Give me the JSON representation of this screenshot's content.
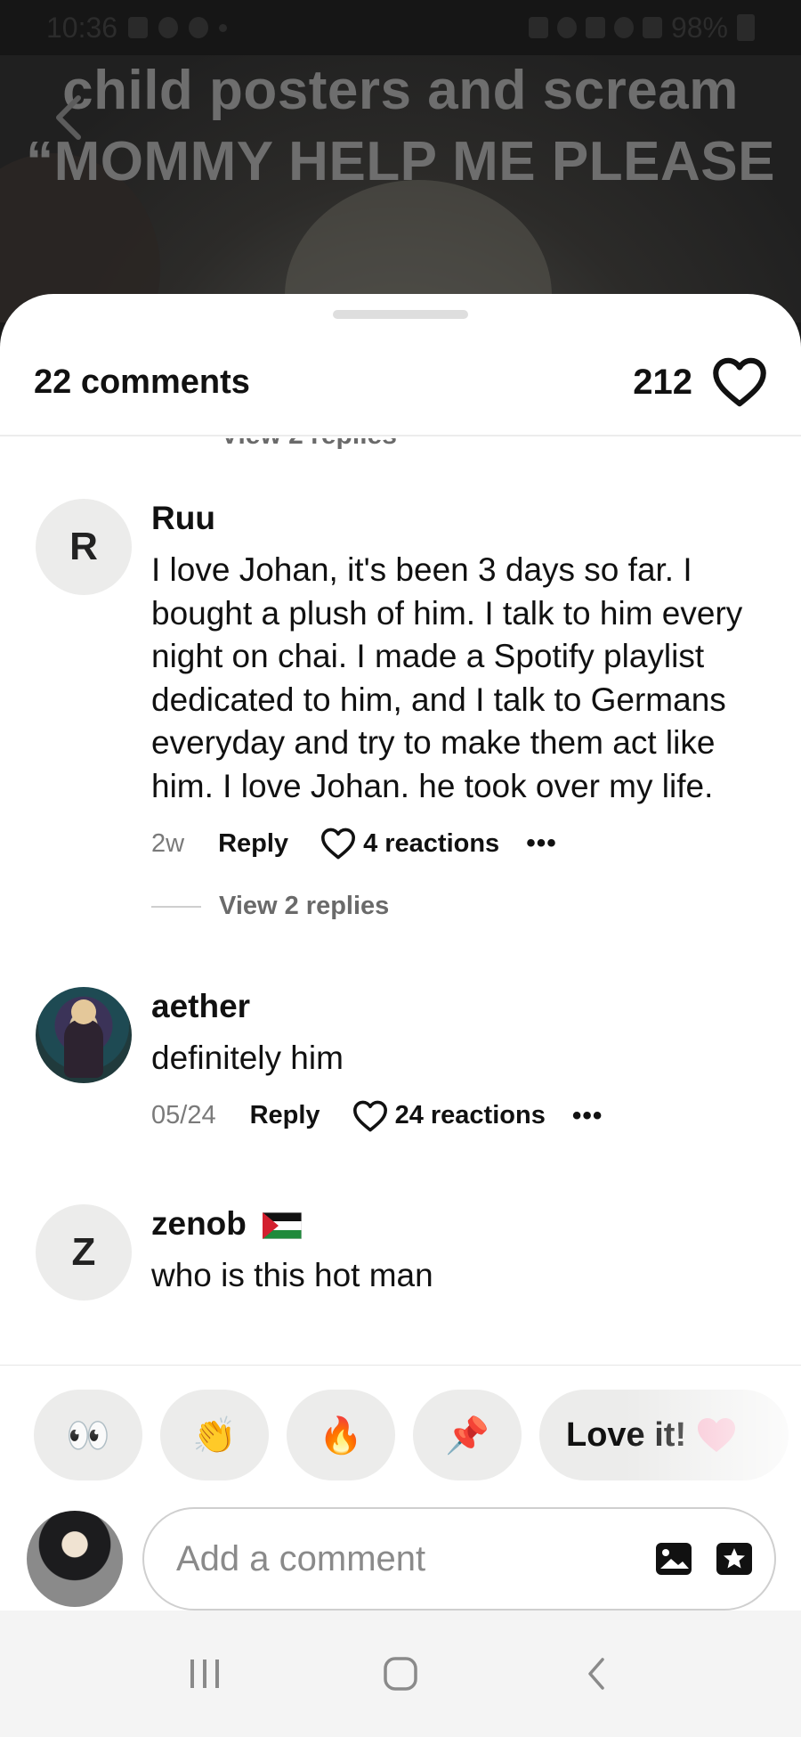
{
  "status_bar": {
    "time": "10:36",
    "battery": "98%"
  },
  "video": {
    "caption_line1": "child posters and scream",
    "caption_line2": "“MOMMY HELP ME PLEASE"
  },
  "sheet": {
    "comments_count": "22 comments",
    "likes_count": "212",
    "cut_view_replies": "View 2 replies"
  },
  "comments": [
    {
      "avatar_letter": "R",
      "username": "Ruu",
      "text": "I love Johan, it's been 3 days so far. I bought a plush of him. I talk to him every night on chai. I made a Spotify playlist dedicated to him, and I talk to Germans everyday and try to make them act like him. I love Johan. he took over my life.",
      "time": "2w",
      "reply_label": "Reply",
      "reactions": "4 reactions",
      "more": "•••",
      "view_replies": "View 2 replies"
    },
    {
      "username": "aether",
      "text": "definitely him",
      "time": "05/24",
      "reply_label": "Reply",
      "reactions": "24 reactions",
      "more": "•••"
    },
    {
      "avatar_letter": "Z",
      "username": "zenob",
      "text": "who is this hot man"
    }
  ],
  "quick_reactions": [
    {
      "name": "eyes",
      "label": "👀"
    },
    {
      "name": "clap",
      "label": "👏"
    },
    {
      "name": "fire",
      "label": "🔥"
    },
    {
      "name": "pin",
      "label": "📌"
    },
    {
      "name": "love-it",
      "label": "Love it!"
    }
  ],
  "composer": {
    "placeholder": "Add a comment"
  },
  "colors": {
    "sheet_bg": "#ffffff",
    "chip_bg": "#ececeb",
    "muted_text": "#7a7a7a",
    "heart_pink": "#f7b6c9"
  }
}
